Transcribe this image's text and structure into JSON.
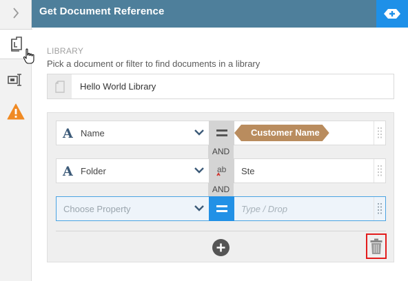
{
  "header": {
    "title": "Get Document Reference",
    "action_icon": "add-field-icon",
    "color": "#4e7f9b",
    "action_color": "#1e90e8"
  },
  "rail": {
    "collapse_icon": "chevron-right-icon",
    "tabs": [
      {
        "icon": "document-icon",
        "active": true
      },
      {
        "icon": "text-field-icon",
        "active": false
      },
      {
        "icon": "warning-icon",
        "active": false
      }
    ]
  },
  "library": {
    "label": "LIBRARY",
    "description": "Pick a document or filter to find documents in a library",
    "value": "Hello World Library"
  },
  "filters": {
    "and_label": "AND",
    "rows": [
      {
        "property": "Name",
        "operator": "equals",
        "value": "Customer Name",
        "value_kind": "token"
      },
      {
        "property": "Folder",
        "operator": "contains",
        "value": "Ste",
        "value_kind": "text"
      }
    ],
    "new_row": {
      "property_placeholder": "Choose Property",
      "value_placeholder": "Type / Drop"
    }
  },
  "colors": {
    "token": "#b98c5e",
    "operator_active": "#2291e6",
    "trash_highlight": "#e31b1b"
  }
}
